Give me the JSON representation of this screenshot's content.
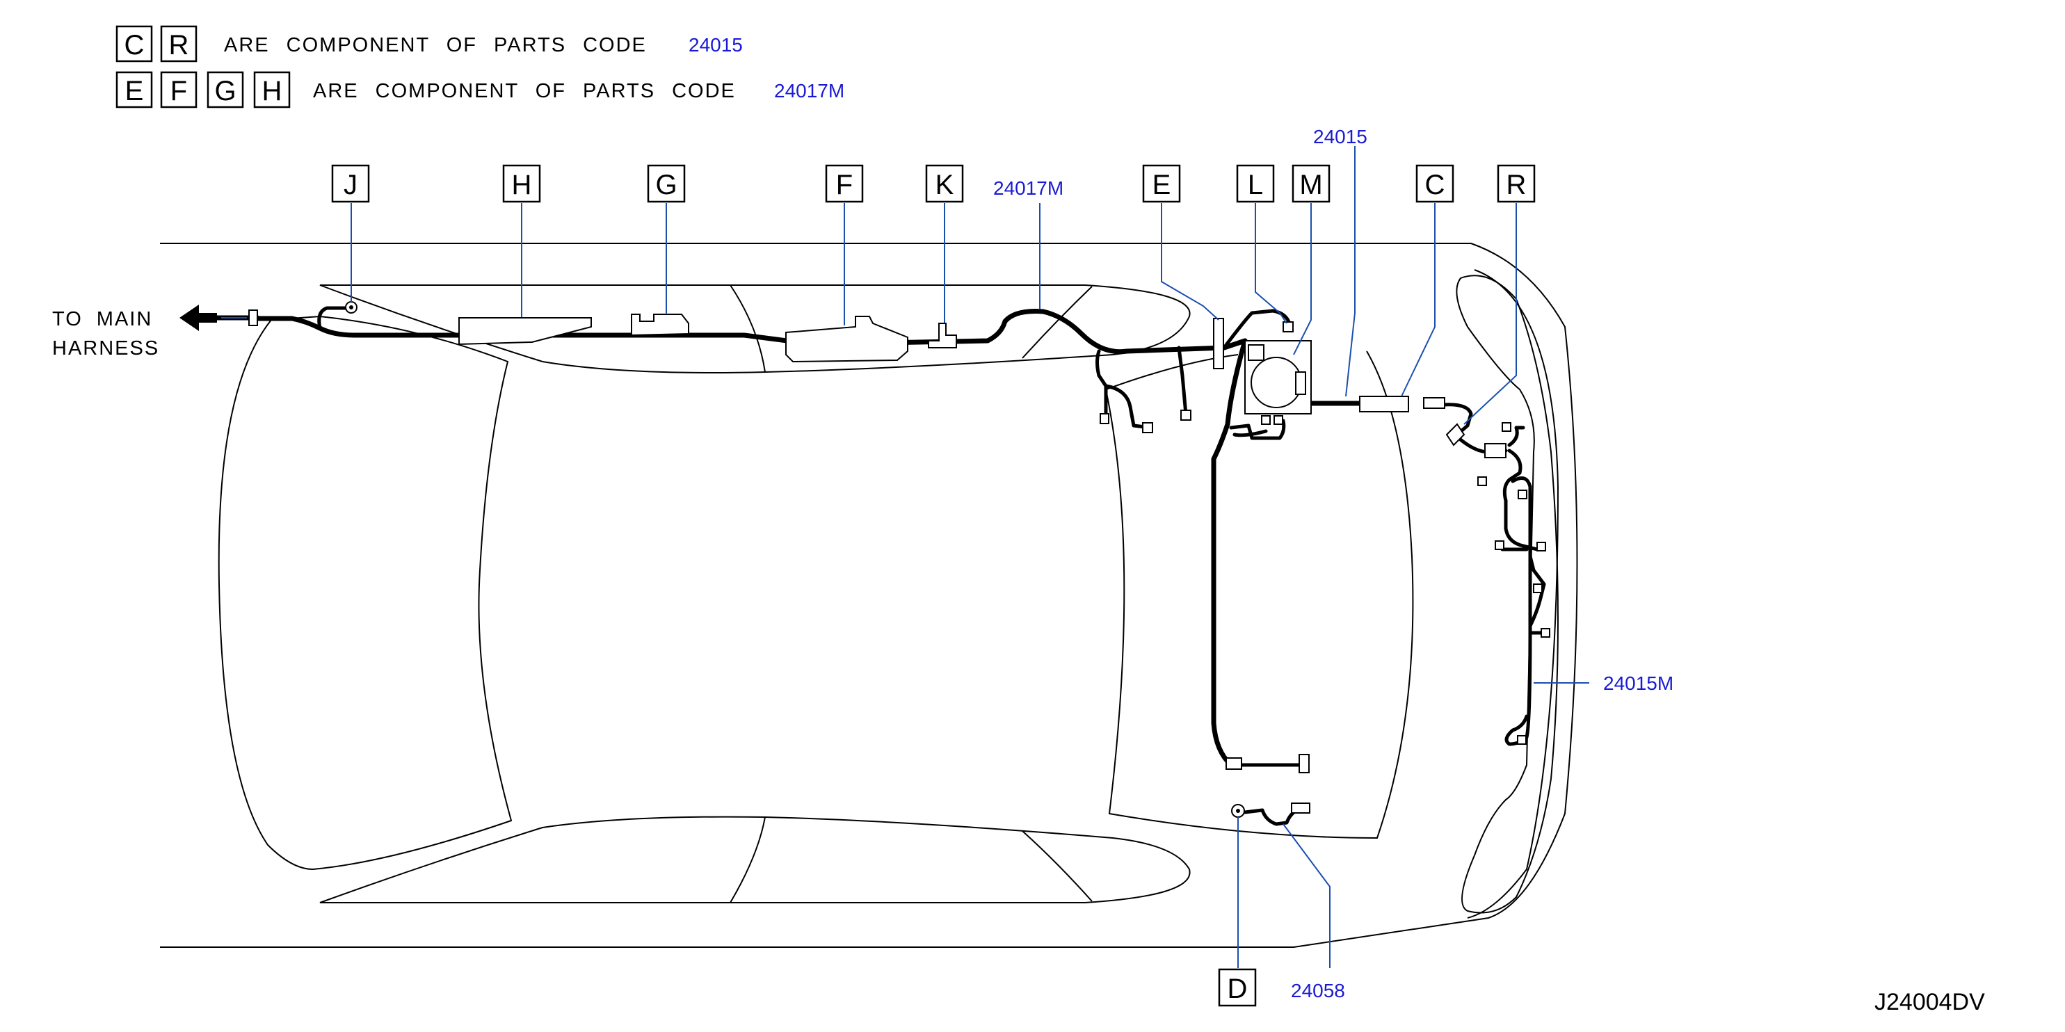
{
  "legend": {
    "row1": {
      "letters": [
        "C",
        "R"
      ],
      "text": "ARE COMPONENT OF PARTS CODE",
      "code": "24015"
    },
    "row2": {
      "letters": [
        "E",
        "F",
        "G",
        "H"
      ],
      "text": "ARE COMPONENT OF PARTS CODE",
      "code": "24017M"
    }
  },
  "callouts": {
    "J": "J",
    "H": "H",
    "G": "G",
    "F": "F",
    "K": "K",
    "E": "E",
    "L": "L",
    "M": "M",
    "C": "C",
    "R": "R",
    "D": "D"
  },
  "part_codes": {
    "top_24015": "24015",
    "top_24017M": "24017M",
    "right_24015M": "24015M",
    "bottom_24058": "24058"
  },
  "side_label": {
    "line1": "TO MAIN",
    "line2": "HARNESS"
  },
  "diagram_id": "J24004DV",
  "icons": {
    "arrow": "left-arrow-icon"
  }
}
